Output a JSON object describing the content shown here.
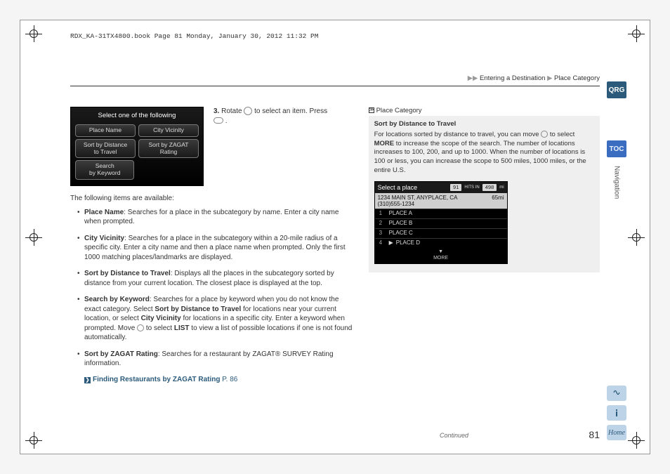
{
  "stamp": "RDX_KA-31TX4800.book  Page 81  Monday, January 30, 2012  11:32 PM",
  "breadcrumb": {
    "arrows": "▶▶",
    "seg1": "Entering a Destination",
    "sep": "▶",
    "seg2": "Place Category"
  },
  "sideTabs": {
    "qrg": "QRG",
    "toc": "TOC",
    "section": "Navigation"
  },
  "sideIcons": {
    "voice": "voice-icon",
    "info": "info-icon",
    "home": "Home"
  },
  "screen1": {
    "title": "Select one of the following",
    "btns": {
      "placeName": "Place Name",
      "cityVicinity": "City Vicinity",
      "sortDist": "Sort by Distance\nto Travel",
      "sortZagat": "Sort by ZAGAT\nRating",
      "keyword": "Search\nby Keyword"
    }
  },
  "step3": {
    "num": "3.",
    "a": "Rotate ",
    "b": " to select an item. Press ",
    "c": "."
  },
  "intro": "The following items are available:",
  "bullets": {
    "b1": {
      "label": "Place Name",
      "text": ": Searches for a place in the subcategory by name. Enter a city name when prompted."
    },
    "b2": {
      "label": "City Vicinity",
      "text": ": Searches for a place in the subcategory within a 20-mile radius of a specific city. Enter a city name and then a place name when prompted. Only the first 1000 matching places/landmarks are displayed."
    },
    "b3": {
      "label": "Sort by Distance to Travel",
      "text": ": Displays all the places in the subcategory sorted by distance from your current location. The closest place is displayed at the top."
    },
    "b4": {
      "label": "Search by Keyword",
      "t1": ": Searches for a place by keyword when you do not know the exact category. Select ",
      "em1": "Sort by Distance to Travel",
      "t2": " for locations near your current location, or select ",
      "em2": "City Vicinity",
      "t3": " for locations in a specific city. Enter a keyword when prompted. Move ",
      "t4": " to select ",
      "em3": "LIST",
      "t5": " to view a list of possible locations if one is not found automatically."
    },
    "b5": {
      "label": "Sort by ZAGAT Rating",
      "text": ": Searches for a restaurant by ZAGAT® SURVEY Rating information."
    }
  },
  "link": {
    "label": "Finding Restaurants by ZAGAT Rating",
    "page": "P. 86"
  },
  "continued": "Continued",
  "pageNum": "81",
  "note": {
    "head": "Place Category",
    "title": "Sort by Distance to Travel",
    "b1": "For locations sorted by distance to travel, you can move ",
    "b2": " to select ",
    "more": "MORE",
    "b3": " to increase the scope of the search. The number of locations increases to 100, 200, and up to 1000. When the number of locations is 100 or less, you can increase the scope to 500 miles, 1000 miles, or the entire U.S."
  },
  "screen2": {
    "title": "Select a place",
    "hits": "91",
    "hitsLabel": "HITS IN",
    "miles": "498",
    "milesUnit": "mi",
    "addr1": "1234 MAIN ST, ANYPLACE, CA",
    "addr2": "(310)555-1234",
    "dist": "65mi",
    "rows": [
      {
        "n": "1",
        "name": "PLACE A"
      },
      {
        "n": "2",
        "name": "PLACE B"
      },
      {
        "n": "3",
        "name": "PLACE C"
      },
      {
        "n": "4",
        "name": "PLACE D"
      }
    ],
    "more": "▼\nMORE"
  }
}
